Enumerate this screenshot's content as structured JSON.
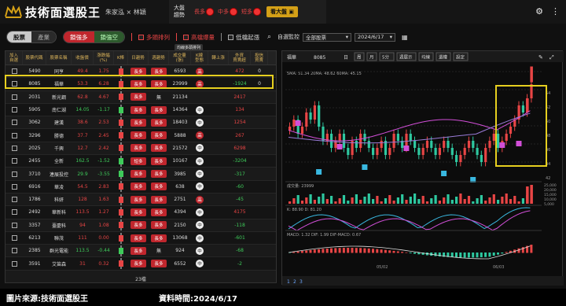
{
  "header": {
    "title": "技術面選股王",
    "authors": "朱家泓 × 林穎",
    "market_label_1": "大盤",
    "market_label_2": "趨勢",
    "long": "長多",
    "mid": "中多",
    "short": "短多",
    "see_market_button": "看大盤"
  },
  "toolbar": {
    "toggle_stock": "股票",
    "toggle_industry": "產業",
    "lock_long": "鎖強多",
    "lock_short": "鎖強空",
    "opt_bull_align": "多頭排列",
    "opt_high_volume": "高檔爆量",
    "opt_low_rise": "低檔起漲",
    "self_select_label": "自選監控",
    "watchlist_value": "全部股票",
    "date_value": "2024/6/17",
    "tooltip": "均線多頭排列"
  },
  "table": {
    "headers": [
      "加入\n自選",
      "股票代碼",
      "股票名稱",
      "收盤價",
      "漲跌幅\n(%)",
      "K棒",
      "日趨勢",
      "週趨勢",
      "成交量\n(張)",
      "K線\n型態",
      "轉上漲",
      "外資\n買賣超",
      "投信\n買賣"
    ],
    "rows": [
      {
        "code": "5490",
        "name": "同亨",
        "close": "49.4",
        "chg": "1.75",
        "d": "長多",
        "w": "長多",
        "vol": "6593",
        "k": "高",
        "t": "",
        "f": "472",
        "i": "0",
        "up": true
      },
      {
        "code": "8085",
        "name": "福華",
        "close": "53.3",
        "chg": "6.28",
        "d": "長多",
        "w": "長多",
        "vol": "23999",
        "k": "高",
        "t": "",
        "f": "-1924",
        "i": "0",
        "up": true
      },
      {
        "code": "2031",
        "name": "新光鋼",
        "close": "62.8",
        "chg": "4.67",
        "d": "長多",
        "w": "無",
        "vol": "21134",
        "k": "",
        "t": "",
        "f": "2417",
        "i": "",
        "up": true
      },
      {
        "code": "5905",
        "name": "南仁湖",
        "close": "14.05",
        "chg": "-1.17",
        "d": "長多",
        "w": "長多",
        "vol": "14364",
        "k": "中",
        "t": "",
        "f": "134",
        "i": "",
        "up": false
      },
      {
        "code": "3062",
        "name": "建漢",
        "close": "38.6",
        "chg": "2.53",
        "d": "長多",
        "w": "長多",
        "vol": "18403",
        "k": "中",
        "t": "",
        "f": "1254",
        "i": "",
        "up": true
      },
      {
        "code": "3296",
        "name": "勝德",
        "close": "37.7",
        "chg": "2.45",
        "d": "長多",
        "w": "長多",
        "vol": "5888",
        "k": "高",
        "t": "",
        "f": "267",
        "i": "",
        "up": true
      },
      {
        "code": "2025",
        "name": "千興",
        "close": "12.7",
        "chg": "2.42",
        "d": "長多",
        "w": "長多",
        "vol": "21572",
        "k": "中",
        "t": "",
        "f": "6298",
        "i": "",
        "up": true
      },
      {
        "code": "2455",
        "name": "全新",
        "close": "162.5",
        "chg": "-1.52",
        "d": "短多",
        "w": "長多",
        "vol": "10167",
        "k": "中",
        "t": "",
        "f": "-3204",
        "i": "",
        "up": false
      },
      {
        "code": "3710",
        "name": "連展投控",
        "close": "29.9",
        "chg": "-3.55",
        "d": "長多",
        "w": "長多",
        "vol": "3985",
        "k": "中",
        "t": "",
        "f": "-317",
        "i": "",
        "up": false
      },
      {
        "code": "6916",
        "name": "華凌",
        "close": "54.5",
        "chg": "2.83",
        "d": "長多",
        "w": "長多",
        "vol": "638",
        "k": "中",
        "t": "",
        "f": "-60",
        "i": "",
        "up": true
      },
      {
        "code": "1786",
        "name": "科妍",
        "close": "128",
        "chg": "1.63",
        "d": "長多",
        "w": "長多",
        "vol": "2751",
        "k": "高",
        "t": "",
        "f": "-45",
        "i": "",
        "up": true
      },
      {
        "code": "2492",
        "name": "華新科",
        "close": "113.5",
        "chg": "1.27",
        "d": "長多",
        "w": "長多",
        "vol": "4394",
        "k": "中",
        "t": "",
        "f": "4175",
        "i": "",
        "up": true
      },
      {
        "code": "3357",
        "name": "臺慶科",
        "close": "94",
        "chg": "1.08",
        "d": "長多",
        "w": "長多",
        "vol": "2150",
        "k": "中",
        "t": "",
        "f": "-118",
        "i": "",
        "up": true
      },
      {
        "code": "6213",
        "name": "聯茂",
        "close": "111",
        "chg": "0.00",
        "d": "長多",
        "w": "長多",
        "vol": "13068",
        "k": "中",
        "t": "",
        "f": "-601",
        "i": "",
        "up": true
      },
      {
        "code": "2385",
        "name": "群光電能",
        "close": "113.5",
        "chg": "-0.44",
        "d": "長多",
        "w": "無",
        "vol": "924",
        "k": "中",
        "t": "",
        "f": "-68",
        "i": "",
        "up": false
      },
      {
        "code": "3591",
        "name": "艾笛森",
        "close": "31",
        "chg": "0.32",
        "d": "長多",
        "w": "長多",
        "vol": "6552",
        "k": "中",
        "t": "",
        "f": "-2",
        "i": "",
        "up": true
      }
    ],
    "footer": "23檔"
  },
  "chart_panel": {
    "stock_name": "福華",
    "stock_code": "8085",
    "period": "日",
    "buttons": [
      "周",
      "月",
      "5分",
      "週展示",
      "均線",
      "還權",
      "設定"
    ],
    "ma_legend": "5MA: 51.34  20MA: 48.62  60MA: 45.15",
    "volume_label": "成交量: 23999",
    "kd_label": "K: 88.90  D: 81.20",
    "macd_label": "MACD: 1.32  DIF: 1.99  DIF-MACD: 0.67",
    "date_1": "05/02",
    "date_2": "06/03",
    "pages": [
      "1",
      "2",
      "3"
    ]
  },
  "bottom": {
    "source": "圖片來源:技術面選股王",
    "time": "資料時間:2024/6/17"
  },
  "colors": {
    "red": "#c0262d",
    "green": "#3ecb5a",
    "gold": "#d4a017",
    "highlight": "#e6cf1f"
  }
}
